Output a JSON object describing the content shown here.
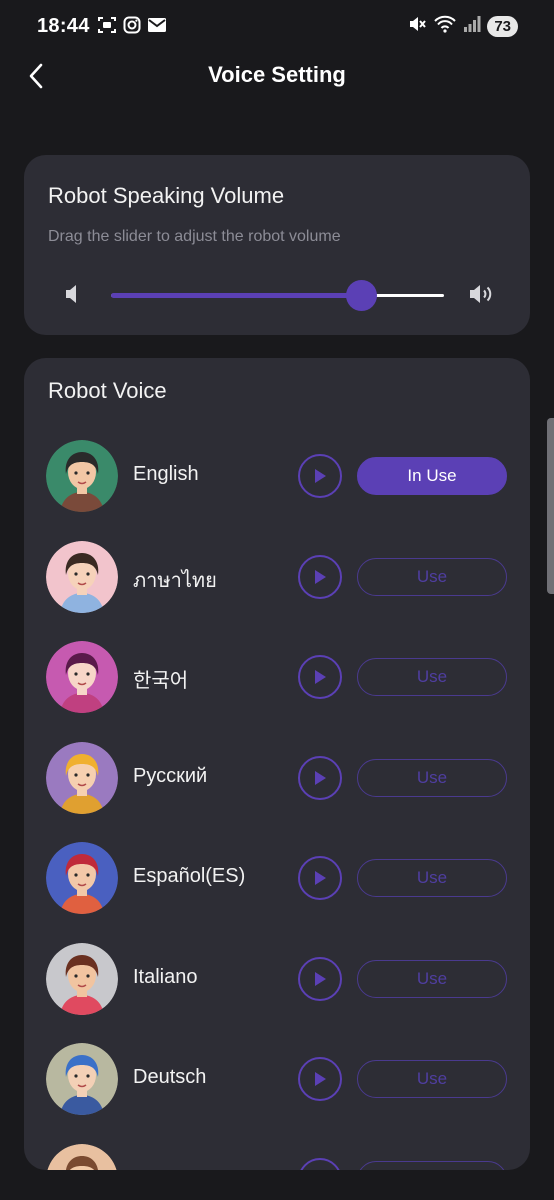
{
  "status_bar": {
    "time": "18:44",
    "battery": "73",
    "left_icons": [
      "screenshot-icon",
      "instagram-icon",
      "mail-icon"
    ],
    "right_icons": [
      "mute-icon",
      "wifi-icon",
      "signal-icon"
    ]
  },
  "header": {
    "title": "Voice Setting",
    "back_icon": "back-arrow-icon"
  },
  "volume_card": {
    "title": "Robot Speaking Volume",
    "description": "Drag the slider to adjust the robot volume",
    "volume_fraction": 0.75
  },
  "voice_card": {
    "title": "Robot Voice",
    "voices": [
      {
        "name": "English",
        "button": "In Use",
        "active": true
      },
      {
        "name": "ภาษาไทย",
        "button": "Use",
        "active": false
      },
      {
        "name": "한국어",
        "button": "Use",
        "active": false
      },
      {
        "name": "Русский",
        "button": "Use",
        "active": false
      },
      {
        "name": "Español(ES)",
        "button": "Use",
        "active": false
      },
      {
        "name": "Italiano",
        "button": "Use",
        "active": false
      },
      {
        "name": "Deutsch",
        "button": "Use",
        "active": false
      },
      {
        "name": "",
        "button": "",
        "active": false
      }
    ]
  },
  "colors": {
    "background": "#19191c",
    "card": "#2d2d35",
    "accent": "#5b40b5"
  }
}
